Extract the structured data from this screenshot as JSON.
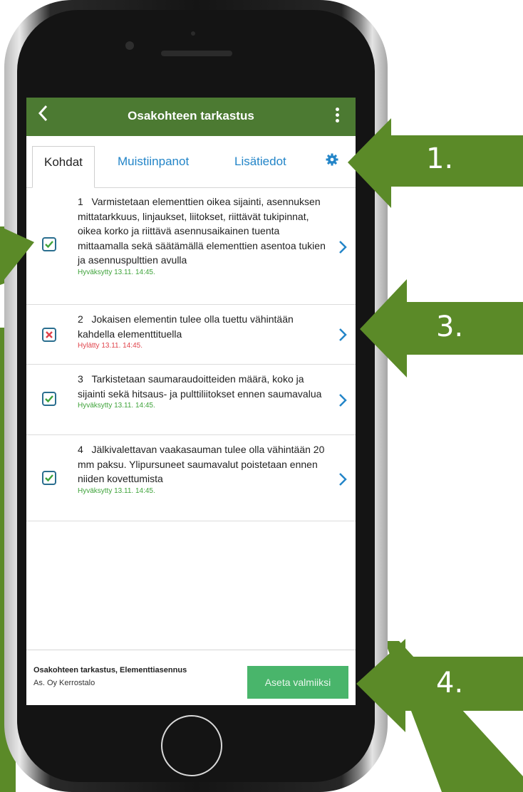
{
  "app_bar": {
    "back_icon": "chevron-left-icon",
    "title": "Osakohteen tarkastus",
    "menu_icon": "kebab-menu-icon"
  },
  "tabs": [
    {
      "label": "Kohdat",
      "active": true
    },
    {
      "label": "Muistiinpanot",
      "active": false
    },
    {
      "label": "Lisätiedot",
      "active": false
    }
  ],
  "settings_icon": "gear-icon",
  "items": [
    {
      "number": "1",
      "text": "Varmistetaan elementtien oikea sijainti, asennuksen mittatarkkuus, linjaukset, liitokset, riittävät tukipinnat, oikea korko ja riittävä asennusaikainen tuenta mittaamalla sekä säätämällä elementtien asentoa tukien ja asennuspulttien avulla",
      "status": "Hyväksytty 13.11. 14:45.",
      "state": "approved"
    },
    {
      "number": "2",
      "text": "Jokaisen elementin tulee olla tuettu vähintään kahdella elementtituella",
      "status": "Hylätty 13.11. 14:45.",
      "state": "rejected"
    },
    {
      "number": "3",
      "text": "Tarkistetaan saumaraudoitteiden määrä, koko ja sijainti sekä hitsaus- ja pulttiliitokset ennen saumavalua",
      "status": "Hyväksytty 13.11. 14:45.",
      "state": "approved"
    },
    {
      "number": "4",
      "text": "Jälkivalettavan vaakasauman tulee olla vähintään 20 mm paksu. Ylipursuneet saumavalut poistetaan ennen niiden kovettumista",
      "status": "Hyväksytty 13.11. 14:45.",
      "state": "approved"
    }
  ],
  "footer": {
    "title": "Osakohteen tarkastus, Elementtiasennus",
    "subtitle": "As. Oy Kerrostalo",
    "button_label": "Aseta valmiiksi"
  },
  "callouts": [
    "1.",
    "3.",
    "4."
  ],
  "colors": {
    "app_bar": "#4c7a32",
    "callout_arrow": "#5b8a28",
    "tab_link": "#2385c8",
    "approved": "#3ea33a",
    "rejected": "#e0434b",
    "primary_button": "#49b56b"
  }
}
